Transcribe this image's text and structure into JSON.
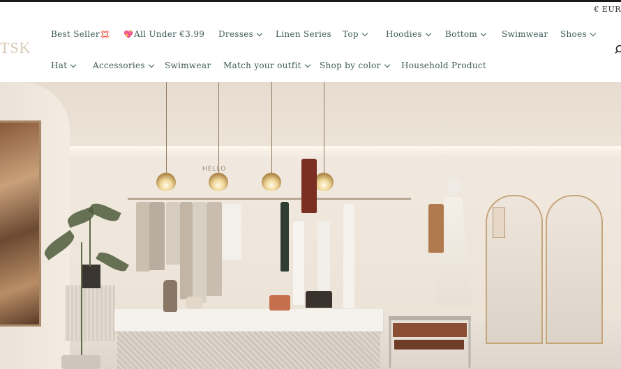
{
  "header": {
    "currency": "€ EUR",
    "logo": "TSK"
  },
  "nav": {
    "row1": [
      {
        "label": "Best Seller",
        "emoji": "💢",
        "dropdown": false
      },
      {
        "label": "All Under €3.99",
        "emoji_before": "💖",
        "dropdown": false
      },
      {
        "label": "Dresses",
        "dropdown": true
      },
      {
        "label": "Linen Series",
        "dropdown": false
      },
      {
        "label": "Top",
        "dropdown": true
      },
      {
        "label": "Hoodies",
        "dropdown": true
      },
      {
        "label": "Bottom",
        "dropdown": true
      },
      {
        "label": "Swimwear",
        "dropdown": false
      },
      {
        "label": "Shoes",
        "dropdown": true
      }
    ],
    "row2": [
      {
        "label": "Hat",
        "dropdown": true
      },
      {
        "label": "Accessories",
        "dropdown": true
      },
      {
        "label": "Swimwear",
        "dropdown": false
      },
      {
        "label": "Match your outfit",
        "dropdown": true
      },
      {
        "label": "Shop by color",
        "dropdown": true
      },
      {
        "label": "Household Product",
        "dropdown": false
      }
    ]
  },
  "hero": {
    "sign_text": "HELLO"
  },
  "icons": {
    "search": "search-icon",
    "chevron": "chevron-down-icon"
  },
  "colors": {
    "nav_text": "#3d5a57",
    "logo": "#d9c9b6",
    "top_bar": "#1a1a1a"
  }
}
